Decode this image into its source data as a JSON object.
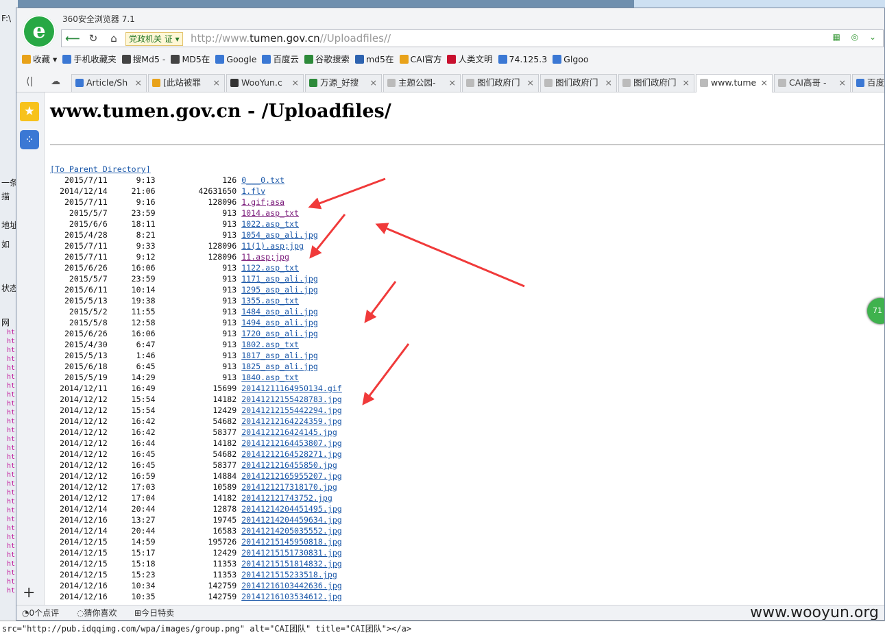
{
  "background": {
    "left_labels": [
      "F:\\",
      "一条",
      "描",
      "地址",
      "如",
      "状态",
      "网"
    ],
    "left_links": [
      "ht",
      "ht",
      "ht",
      "ht",
      "ht",
      "ht",
      "ht",
      "ht",
      "ht",
      "ht",
      "ht",
      "ht",
      "ht",
      "ht",
      "ht",
      "ht",
      "ht",
      "ht",
      "ht",
      "ht",
      "ht",
      "ht",
      "ht",
      "ht",
      "ht",
      "ht",
      "ht",
      "ht",
      "ht",
      "ht"
    ],
    "bottom_code": "src=\"http://pub.idqqimg.com/wpa/images/group.png\" alt=\"CAI团队\" title=\"CAI团队\"></a>"
  },
  "browser": {
    "app_title": "360安全浏览器 7.1",
    "logo_glyph": "e",
    "site_tag": "党政机关 证 ▾",
    "url_prefix": "http://www.",
    "url_host": "tumen.gov.cn",
    "url_path": "//Uploadfiles//",
    "addr_icons": "▦ ◎ ⌄",
    "bookmarks": [
      {
        "label": "收藏 ▾",
        "color": "#e8a21a"
      },
      {
        "label": "手机收藏夹",
        "color": "#3b78d4"
      },
      {
        "label": "搜Md5 -",
        "color": "#444"
      },
      {
        "label": "MD5在",
        "color": "#444"
      },
      {
        "label": "Google",
        "color": "#3b78d4"
      },
      {
        "label": "百度云",
        "color": "#3b78d4"
      },
      {
        "label": "谷歌搜索",
        "color": "#2d8a3a"
      },
      {
        "label": "md5在",
        "color": "#2d63b0"
      },
      {
        "label": "CAI官方",
        "color": "#e8a21a"
      },
      {
        "label": "人类文明",
        "color": "#c8102e"
      },
      {
        "label": "74.125.3",
        "color": "#3b78d4"
      },
      {
        "label": "Glgoo",
        "color": "#3b78d4"
      }
    ],
    "tabs": [
      {
        "label": "Article/Sh",
        "color": "#3b78d4"
      },
      {
        "label": "[此站被罪",
        "color": "#e8a21a"
      },
      {
        "label": "WooYun.c",
        "color": "#333"
      },
      {
        "label": "万源_好搜",
        "color": "#2d8a3a"
      },
      {
        "label": "主题公园-",
        "color": "#bbb"
      },
      {
        "label": "图们政府门",
        "color": "#bbb"
      },
      {
        "label": "图们政府门",
        "color": "#bbb"
      },
      {
        "label": "图们政府门",
        "color": "#bbb"
      },
      {
        "label": "www.tume",
        "color": "#bbb"
      },
      {
        "label": "CAI高哥 -",
        "color": "#bbb"
      },
      {
        "label": "百度",
        "color": "#3b78d4"
      }
    ],
    "sidebar_ball": "71"
  },
  "page": {
    "title": "www.tumen.gov.cn - /Uploadfiles/",
    "parent_link": "[To Parent Directory]",
    "entries": [
      {
        "date": "2015/7/11",
        "time": "9:13",
        "size": "126",
        "name": "0___0.txt",
        "visited": false
      },
      {
        "date": "2014/12/14",
        "time": "21:06",
        "size": "42631650",
        "name": "1.flv",
        "visited": false
      },
      {
        "date": "2015/7/11",
        "time": "9:16",
        "size": "128096",
        "name": "1.gif;asa",
        "visited": true
      },
      {
        "date": "2015/5/7",
        "time": "23:59",
        "size": "913",
        "name": "1014.asp_txt",
        "visited": true
      },
      {
        "date": "2015/6/6",
        "time": "18:11",
        "size": "913",
        "name": "1022.asp_txt",
        "visited": false
      },
      {
        "date": "2015/4/28",
        "time": "8:21",
        "size": "913",
        "name": "1054_asp_ali.jpg",
        "visited": false
      },
      {
        "date": "2015/7/11",
        "time": "9:33",
        "size": "128096",
        "name": "11(1).asp;jpg",
        "visited": false
      },
      {
        "date": "2015/7/11",
        "time": "9:12",
        "size": "128096",
        "name": "11.asp;jpg",
        "visited": true
      },
      {
        "date": "2015/6/26",
        "time": "16:06",
        "size": "913",
        "name": "1122.asp_txt",
        "visited": false
      },
      {
        "date": "2015/5/7",
        "time": "23:59",
        "size": "913",
        "name": "1171_asp_ali.jpg",
        "visited": false
      },
      {
        "date": "2015/6/11",
        "time": "10:14",
        "size": "913",
        "name": "1295_asp_ali.jpg",
        "visited": false
      },
      {
        "date": "2015/5/13",
        "time": "19:38",
        "size": "913",
        "name": "1355.asp_txt",
        "visited": false
      },
      {
        "date": "2015/5/2",
        "time": "11:55",
        "size": "913",
        "name": "1484_asp_ali.jpg",
        "visited": false
      },
      {
        "date": "2015/5/8",
        "time": "12:58",
        "size": "913",
        "name": "1494_asp_ali.jpg",
        "visited": false
      },
      {
        "date": "2015/6/26",
        "time": "16:06",
        "size": "913",
        "name": "1720_asp_ali.jpg",
        "visited": false
      },
      {
        "date": "2015/4/30",
        "time": "6:47",
        "size": "913",
        "name": "1802.asp_txt",
        "visited": false
      },
      {
        "date": "2015/5/13",
        "time": "1:46",
        "size": "913",
        "name": "1817_asp_ali.jpg",
        "visited": false
      },
      {
        "date": "2015/6/18",
        "time": "6:45",
        "size": "913",
        "name": "1825_asp_ali.jpg",
        "visited": false
      },
      {
        "date": "2015/5/19",
        "time": "14:29",
        "size": "913",
        "name": "1840.asp_txt",
        "visited": false
      },
      {
        "date": "2014/12/11",
        "time": "16:49",
        "size": "15699",
        "name": "20141211164950134.gif",
        "visited": false
      },
      {
        "date": "2014/12/12",
        "time": "15:54",
        "size": "14182",
        "name": "20141212155428783.jpg",
        "visited": false
      },
      {
        "date": "2014/12/12",
        "time": "15:54",
        "size": "12429",
        "name": "20141212155442294.jpg",
        "visited": false
      },
      {
        "date": "2014/12/12",
        "time": "16:42",
        "size": "54682",
        "name": "20141212164224359.jpg",
        "visited": false
      },
      {
        "date": "2014/12/12",
        "time": "16:42",
        "size": "58377",
        "name": "2014121216424145.jpg",
        "visited": false
      },
      {
        "date": "2014/12/12",
        "time": "16:44",
        "size": "14182",
        "name": "20141212164453807.jpg",
        "visited": false
      },
      {
        "date": "2014/12/12",
        "time": "16:45",
        "size": "54682",
        "name": "20141212164528271.jpg",
        "visited": false
      },
      {
        "date": "2014/12/12",
        "time": "16:45",
        "size": "58377",
        "name": "2014121216455850.jpg",
        "visited": false
      },
      {
        "date": "2014/12/12",
        "time": "16:59",
        "size": "14884",
        "name": "20141212165955207.jpg",
        "visited": false
      },
      {
        "date": "2014/12/12",
        "time": "17:03",
        "size": "10589",
        "name": "2014121217318170.jpg",
        "visited": false
      },
      {
        "date": "2014/12/12",
        "time": "17:04",
        "size": "14182",
        "name": "201412121743752.jpg",
        "visited": false
      },
      {
        "date": "2014/12/14",
        "time": "20:44",
        "size": "12878",
        "name": "20141214204451495.jpg",
        "visited": false
      },
      {
        "date": "2014/12/16",
        "time": "13:27",
        "size": "19745",
        "name": "20141214204459634.jpg",
        "visited": false
      },
      {
        "date": "2014/12/14",
        "time": "20:44",
        "size": "16583",
        "name": "20141214205035552.jpg",
        "visited": false
      },
      {
        "date": "2014/12/15",
        "time": "14:59",
        "size": "195726",
        "name": "20141215145950818.jpg",
        "visited": false
      },
      {
        "date": "2014/12/15",
        "time": "15:17",
        "size": "12429",
        "name": "20141215151730831.jpg",
        "visited": false
      },
      {
        "date": "2014/12/15",
        "time": "15:18",
        "size": "11353",
        "name": "20141215151814832.jpg",
        "visited": false
      },
      {
        "date": "2014/12/15",
        "time": "15:23",
        "size": "11353",
        "name": "2014121515233518.jpg",
        "visited": false
      },
      {
        "date": "2014/12/16",
        "time": "10:34",
        "size": "142759",
        "name": "20141216103442636.jpg",
        "visited": false
      },
      {
        "date": "2014/12/16",
        "time": "10:35",
        "size": "142759",
        "name": "20141216103534612.jpg",
        "visited": false
      }
    ]
  },
  "statusbar": {
    "comments": "0个点评",
    "guess": "猜你喜欢",
    "deals": "今日特卖",
    "watermark": "www.wooyun.org"
  },
  "colors": {
    "link": "#1a57a8",
    "visited": "#7a1a7a",
    "arrow": "#f03a3a",
    "logo": "#27a844"
  }
}
